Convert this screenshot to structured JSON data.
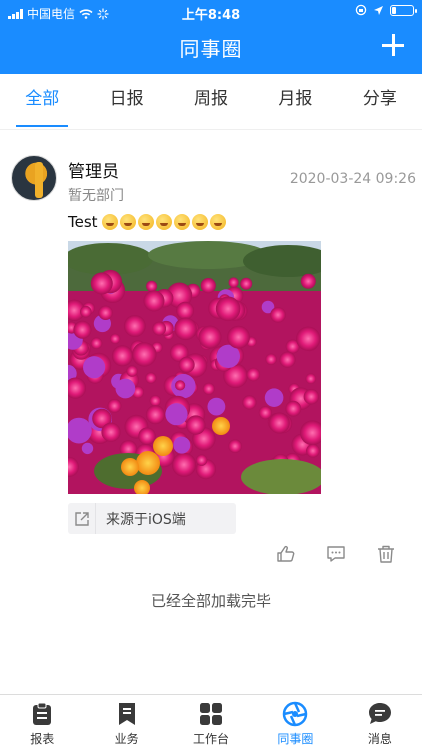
{
  "status_bar": {
    "carrier": "中国电信",
    "time": "上午8:48"
  },
  "nav": {
    "title": "同事圈",
    "add_icon": "plus-icon"
  },
  "tabs": [
    {
      "label": "全部",
      "active": true
    },
    {
      "label": "日报",
      "active": false
    },
    {
      "label": "周报",
      "active": false
    },
    {
      "label": "月报",
      "active": false
    },
    {
      "label": "分享",
      "active": false
    }
  ],
  "post": {
    "author": "管理员",
    "department": "暂无部门",
    "timestamp": "2020-03-24 09:26",
    "text": "Test",
    "emoji_count": 7,
    "source": "来源于iOS端",
    "action_icons": [
      "thumbs-up-icon",
      "comment-icon",
      "trash-icon"
    ]
  },
  "end_message": "已经全部加载完毕",
  "tabbar": [
    {
      "label": "报表",
      "icon": "clipboard-icon",
      "active": false
    },
    {
      "label": "业务",
      "icon": "document-icon",
      "active": false
    },
    {
      "label": "工作台",
      "icon": "grid-icon",
      "active": false
    },
    {
      "label": "同事圈",
      "icon": "shutter-icon",
      "active": true
    },
    {
      "label": "消息",
      "icon": "chat-bubble-icon",
      "active": false
    }
  ],
  "colors": {
    "accent": "#1a8cff",
    "text_muted": "#999999"
  }
}
